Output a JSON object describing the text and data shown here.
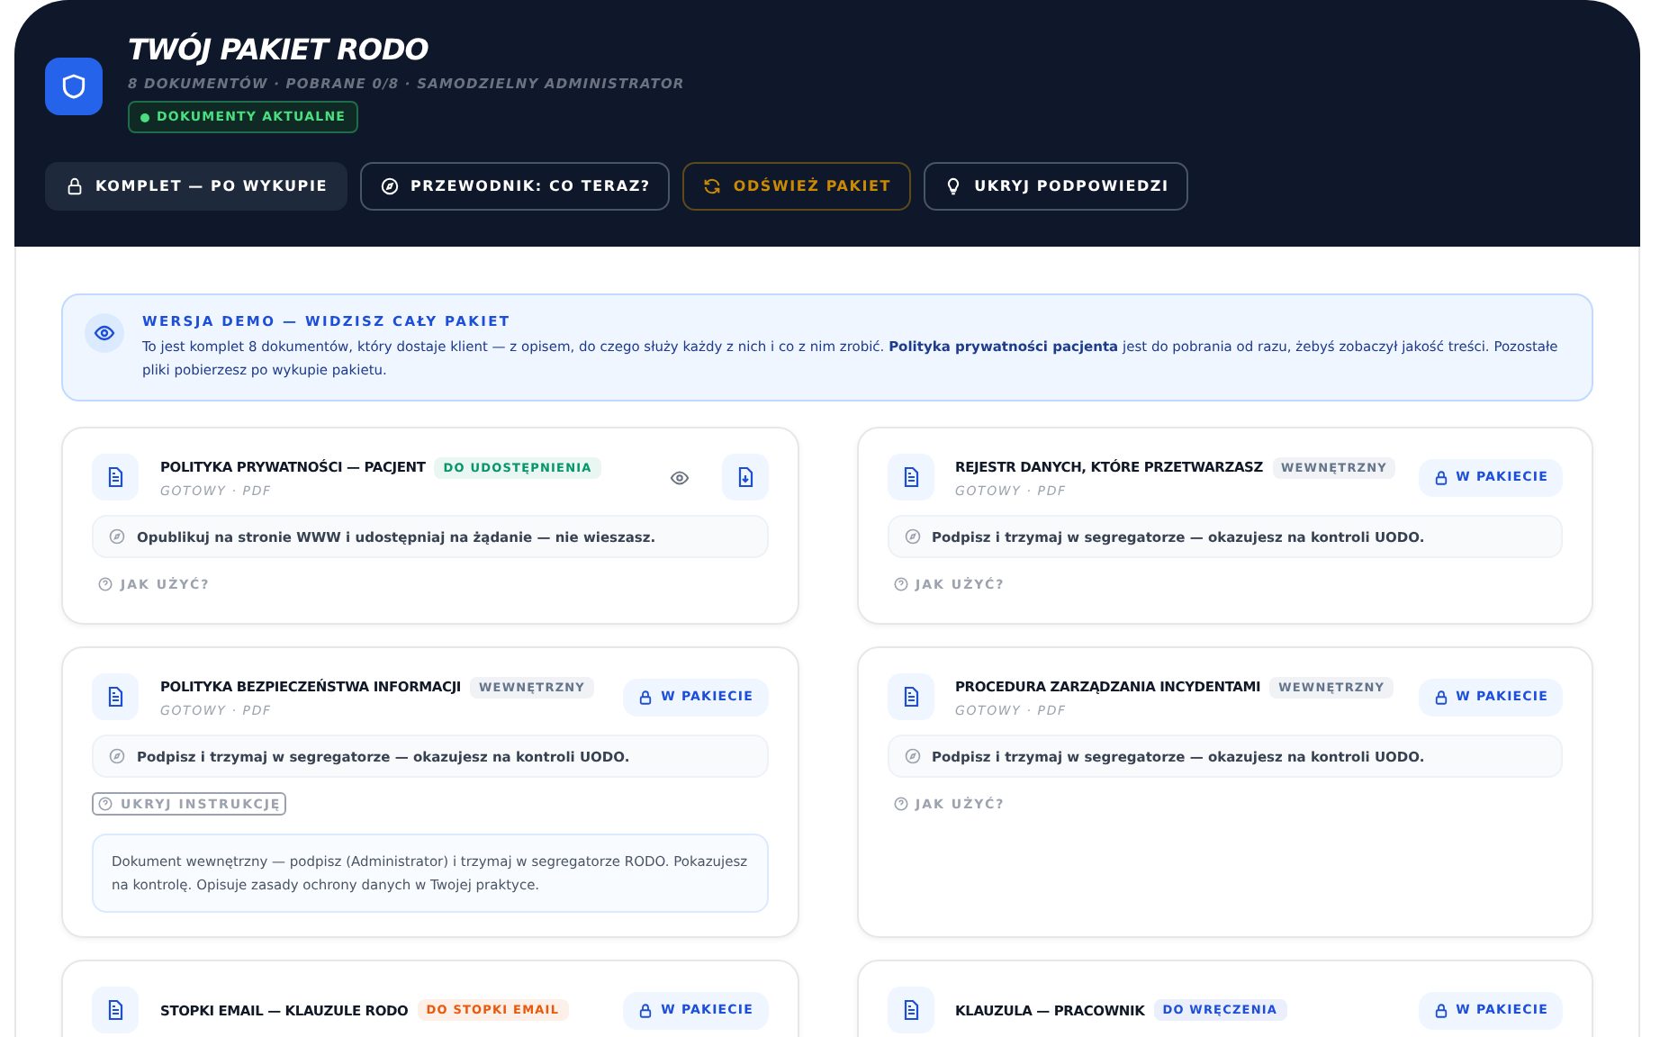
{
  "header": {
    "title": "TWÓJ PAKIET RODO",
    "subtitle": "8 DOKUMENTÓW · POBRANE 0/8 · SAMODZIELNY ADMINISTRATOR",
    "status": "DOKUMENTY AKTUALNE"
  },
  "actions": [
    {
      "kind": "locked",
      "label": "KOMPLET — PO WYKUPIE"
    },
    {
      "kind": "guide",
      "label": "PRZEWODNIK: CO TERAZ?"
    },
    {
      "kind": "refresh",
      "label": "ODŚWIEŻ PAKIET"
    },
    {
      "kind": "hints",
      "label": "UKRYJ PODPOWIEDZI"
    }
  ],
  "notice": {
    "title": "WERSJA DEMO — WIDZISZ CAŁY PAKIET",
    "text": "To jest komplet 8 dokumentów, który dostaje klient — z opisem, do czego służy każdy z nich i co z nim zrobić. **Polityka prywatności pacjenta** jest do pobrania od razu, żebyś zobaczył jakość treści. Pozostałe pliki pobierzesz po wykupie pakietu."
  },
  "documents": [
    {
      "title": "POLITYKA PRYWATNOŚCI — PACJENT",
      "tag": "DO UDOSTĘPNIENIA",
      "color": "#059669",
      "meta": "GOTOWY · PDF",
      "action": {
        "kind": "download"
      },
      "hint": "Opublikuj na stronie WWW i udostępniaj na żądanie — nie wieszasz.",
      "help": {
        "label": "JAK UŻYĆ?",
        "expanded": false
      }
    },
    {
      "title": "REJESTR DANYCH, KTÓRE PRZETWARZASZ",
      "tag": "WEWNĘTRZNY",
      "color": "#64748b",
      "meta": "GOTOWY · PDF",
      "action": {
        "kind": "locked",
        "label": "W PAKIECIE"
      },
      "hint": "Podpisz i trzymaj w segregatorze — okazujesz na kontroli UODO.",
      "help": {
        "label": "JAK UŻYĆ?",
        "expanded": false
      }
    },
    {
      "title": "POLITYKA BEZPIECZEŃSTWA INFORMACJI",
      "tag": "WEWNĘTRZNY",
      "color": "#64748b",
      "meta": "GOTOWY · PDF",
      "action": {
        "kind": "locked",
        "label": "W PAKIECIE"
      },
      "hint": "Podpisz i trzymaj w segregatorze — okazujesz na kontroli UODO.",
      "help": {
        "label": "UKRYJ INSTRUKCJĘ",
        "expanded": true,
        "text": "Dokument wewnętrzny — podpisz (Administrator) i trzymaj w segregatorze RODO. Pokazujesz na kontrolę. Opisuje zasady ochrony danych w Twojej praktyce."
      }
    },
    {
      "title": "PROCEDURA ZARZĄDZANIA INCYDENTAMI",
      "tag": "WEWNĘTRZNY",
      "color": "#64748b",
      "meta": "GOTOWY · PDF",
      "action": {
        "kind": "locked",
        "label": "W PAKIECIE"
      },
      "hint": "Podpisz i trzymaj w segregatorze — okazujesz na kontroli UODO.",
      "help": {
        "label": "JAK UŻYĆ?",
        "expanded": false
      }
    },
    {
      "title": "STOPKI EMAIL — KLAUZULE RODO",
      "tag": "DO STOPKI EMAIL",
      "color": "#ea580c",
      "action": {
        "kind": "locked",
        "label": "W PAKIECIE"
      }
    },
    {
      "title": "KLAUZULA — PRACOWNIK",
      "tag": "DO WRĘCZENIA",
      "color": "#1d4ed8",
      "action": {
        "kind": "locked",
        "label": "W PAKIECIE"
      }
    }
  ]
}
